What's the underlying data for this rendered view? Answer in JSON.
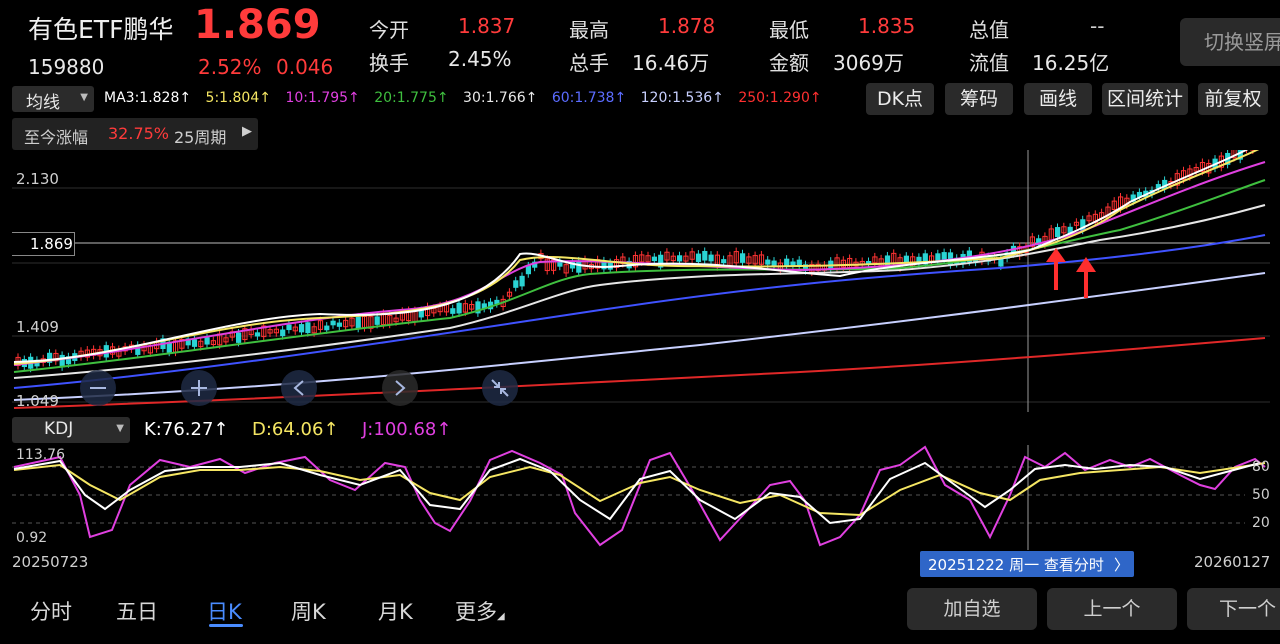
{
  "header": {
    "name": "有色ETF鹏华",
    "price": "1.869",
    "code": "159880",
    "change_pct": "2.52%",
    "change_abs": "0.046",
    "stats": [
      {
        "label": "今开",
        "value": "1.837",
        "color": "#ff3b3b"
      },
      {
        "label": "最高",
        "value": "1.878",
        "color": "#ff3b3b"
      },
      {
        "label": "最低",
        "value": "1.835",
        "color": "#ff3b3b"
      },
      {
        "label": "总值",
        "value": "--",
        "color": "#cfcfcf"
      },
      {
        "label": "换手",
        "value": "2.45%",
        "color": "#e8e8e8"
      },
      {
        "label": "总手",
        "value": "16.46万",
        "color": "#e8e8e8"
      },
      {
        "label": "金额",
        "value": "3069万",
        "color": "#e8e8e8"
      },
      {
        "label": "流值",
        "value": "16.25亿",
        "color": "#e8e8e8"
      }
    ],
    "switch_button": "切换竖屏"
  },
  "ma_bar": {
    "selector": "均线",
    "items": [
      {
        "text": "MA3:1.828↑",
        "color": "#ffffff"
      },
      {
        "text": "5:1.804↑",
        "color": "#f5e663"
      },
      {
        "text": "10:1.795↑",
        "color": "#e040e0"
      },
      {
        "text": "20:1.775↑",
        "color": "#3fbf3f"
      },
      {
        "text": "30:1.766↑",
        "color": "#e8e8e8"
      },
      {
        "text": "60:1.738↑",
        "color": "#4a5cff"
      },
      {
        "text": "120:1.536↑",
        "color": "#c8d0ff"
      },
      {
        "text": "250:1.290↑",
        "color": "#ff3030"
      }
    ],
    "buttons": [
      "DK点",
      "筹码",
      "画线",
      "区间统计",
      "前复权"
    ]
  },
  "period_info": {
    "label": "至今涨幅",
    "pct": "32.75%",
    "periods": "25周期"
  },
  "price_axis": [
    "2.130",
    "1.869",
    "1.409",
    "1.049"
  ],
  "kdj_bar": {
    "selector": "KDJ",
    "k": "K:76.27↑",
    "d": "D:64.06↑",
    "j": "J:100.68↑",
    "k_color": "#ffffff",
    "d_color": "#f5e663",
    "j_color": "#e040e0"
  },
  "kdj_axis": {
    "top": "113.76",
    "bottom": "0.92",
    "right_ticks": [
      "80",
      "50",
      "20"
    ]
  },
  "dates": {
    "start": "20250723",
    "end": "20260127",
    "cursor": "20251222 周一 查看分时"
  },
  "tabs": [
    "分时",
    "五日",
    "日K",
    "周K",
    "月K",
    "更多"
  ],
  "active_tab": "日K",
  "bottom_buttons": [
    "加自选",
    "上一个",
    "下一个"
  ],
  "chart_data": {
    "type": "line",
    "series_names": [
      "MA3",
      "MA5",
      "MA10",
      "MA20",
      "MA30",
      "MA60",
      "MA120",
      "MA250"
    ],
    "ma_values": [
      1.828,
      1.804,
      1.795,
      1.775,
      1.766,
      1.738,
      1.536,
      1.29
    ],
    "current_price": 1.869,
    "y_ticks": [
      2.13,
      1.869,
      1.409,
      1.049
    ]
  }
}
